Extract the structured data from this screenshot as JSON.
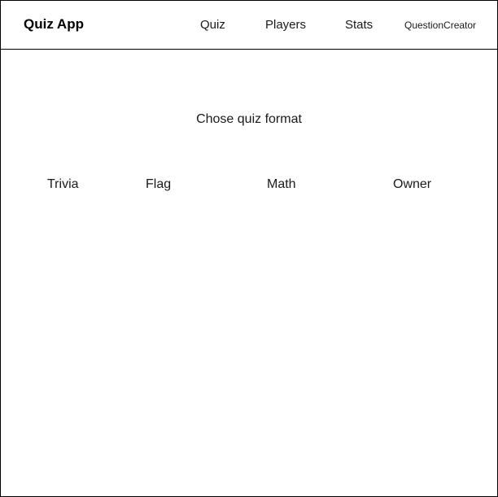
{
  "header": {
    "brand": "Quiz App",
    "nav": [
      {
        "label": "Quiz"
      },
      {
        "label": "Players"
      },
      {
        "label": "Stats"
      },
      {
        "label": "QuestionCreator"
      }
    ]
  },
  "main": {
    "prompt": "Chose quiz format",
    "formats": [
      {
        "label": "Trivia"
      },
      {
        "label": "Flag"
      },
      {
        "label": "Math"
      },
      {
        "label": "Owner"
      }
    ]
  }
}
